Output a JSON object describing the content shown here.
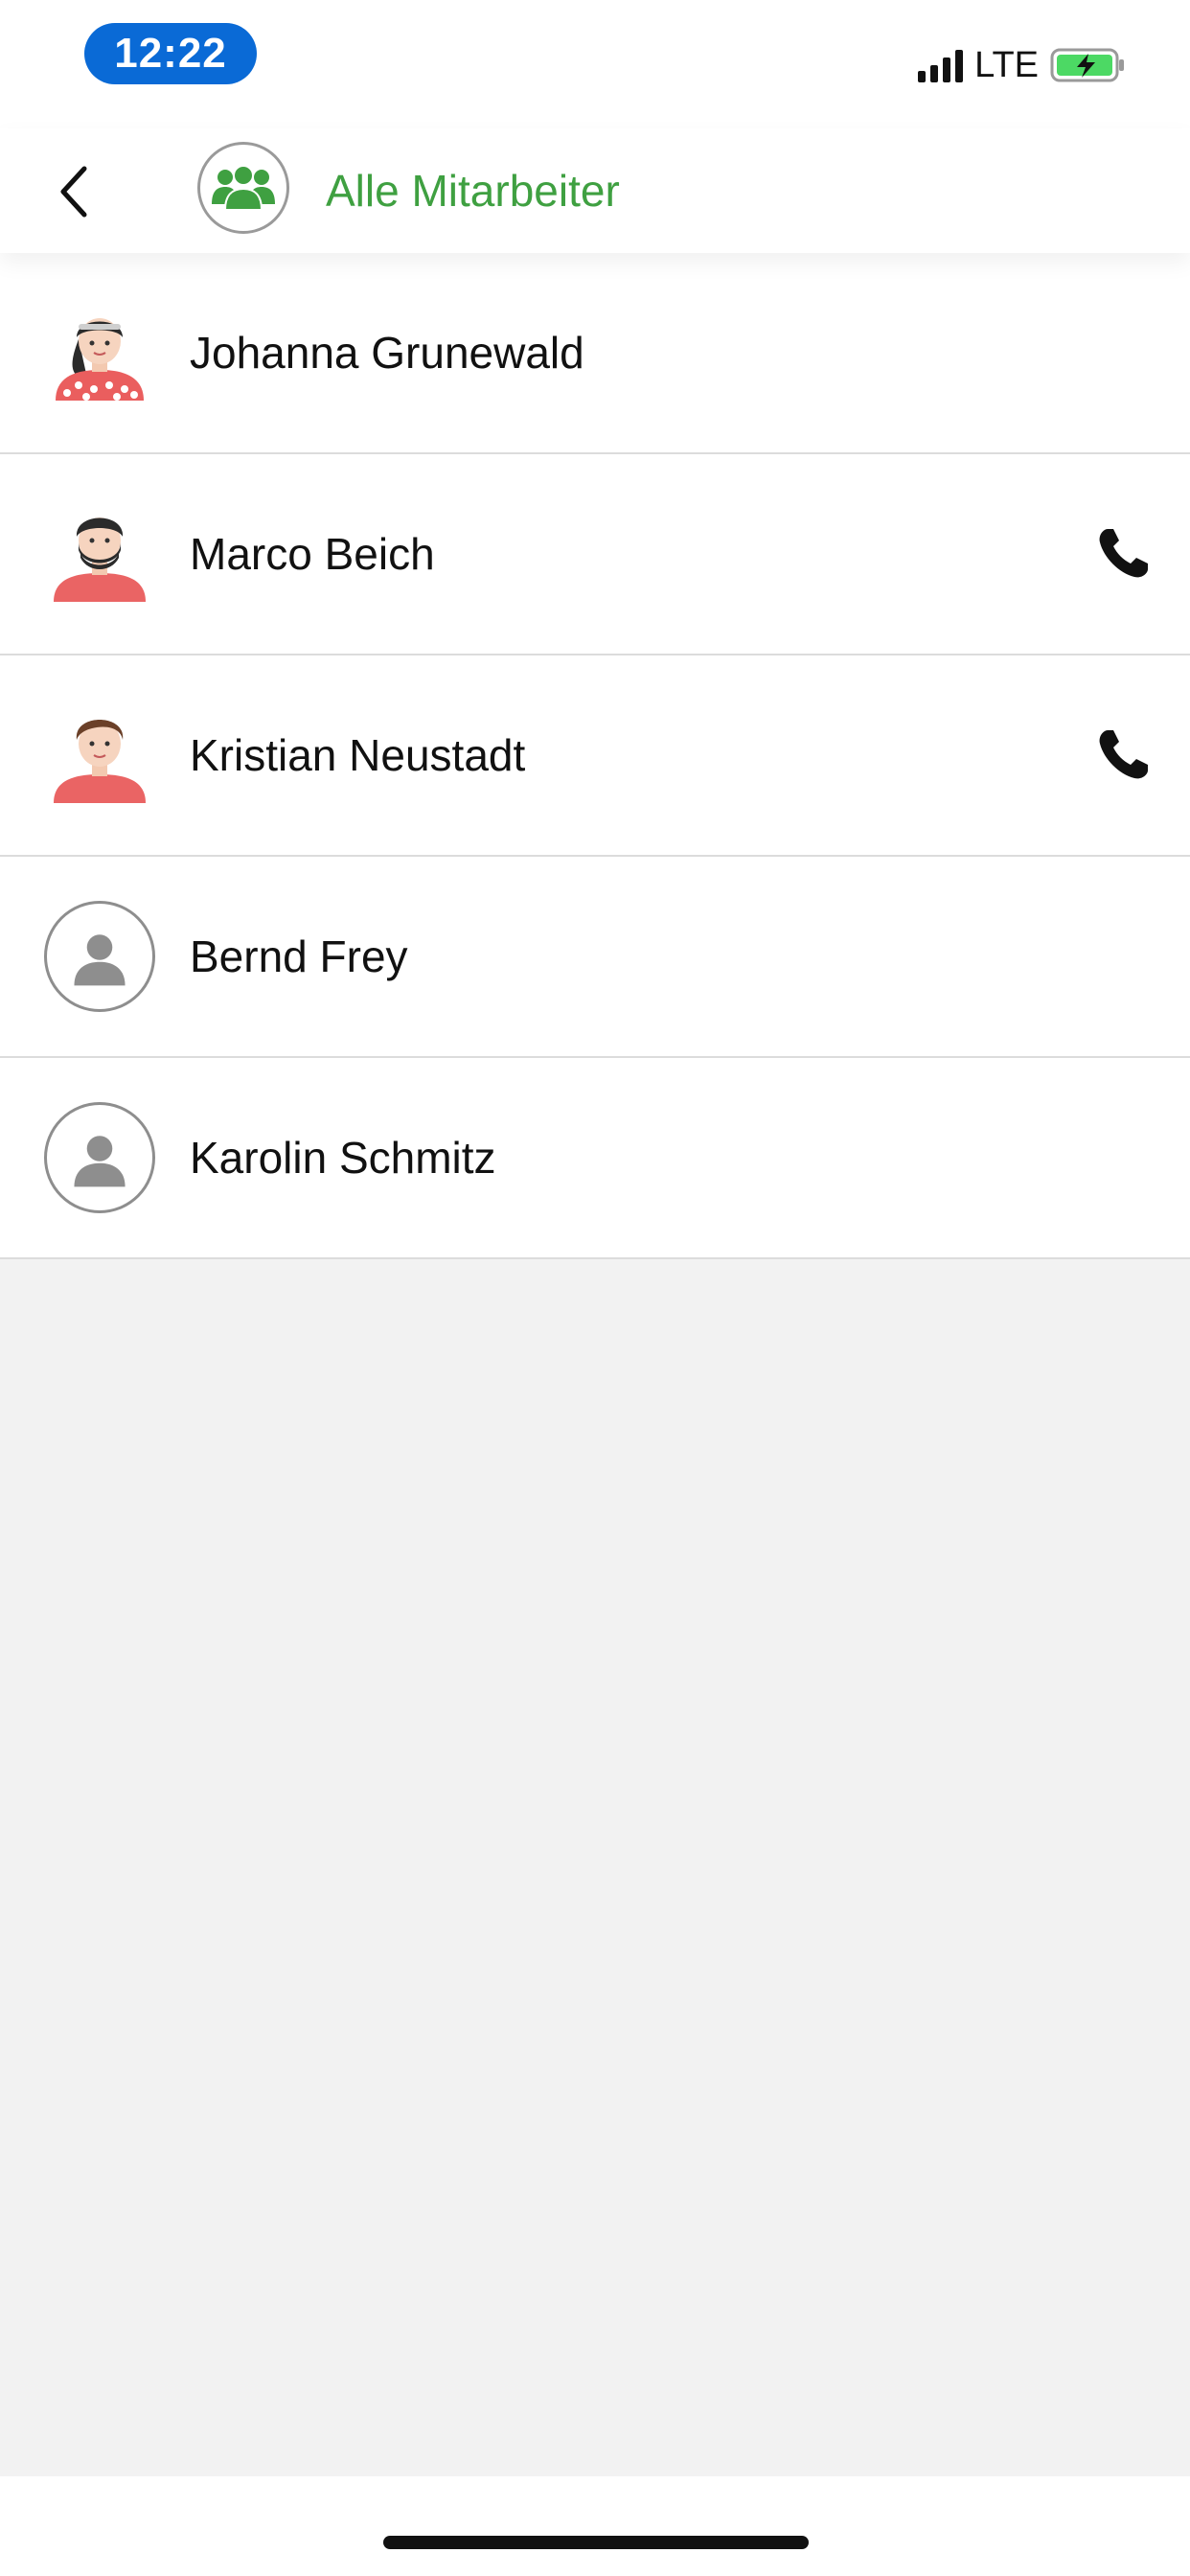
{
  "status_bar": {
    "time": "12:22",
    "network": "LTE",
    "icons": [
      "signal-icon",
      "battery-charging-icon"
    ],
    "colors": {
      "time_pill": "#0a6ad6",
      "battery": "#4cd964"
    }
  },
  "header": {
    "back_icon": "chevron-left-icon",
    "group_icon": "group-people-icon",
    "title": "Alle Mitarbeiter",
    "title_color": "#3fa041"
  },
  "contacts": [
    {
      "name": "Johanna Grunewald",
      "avatar": "woman-avatar-icon",
      "has_call": false
    },
    {
      "name": "Marco Beich",
      "avatar": "bearded-man-avatar-icon",
      "has_call": true
    },
    {
      "name": "Kristian Neustadt",
      "avatar": "man-avatar-icon",
      "has_call": true
    },
    {
      "name": "Bernd Frey",
      "avatar": "default-person-icon",
      "has_call": false
    },
    {
      "name": "Karolin Schmitz",
      "avatar": "default-person-icon",
      "has_call": false
    }
  ]
}
